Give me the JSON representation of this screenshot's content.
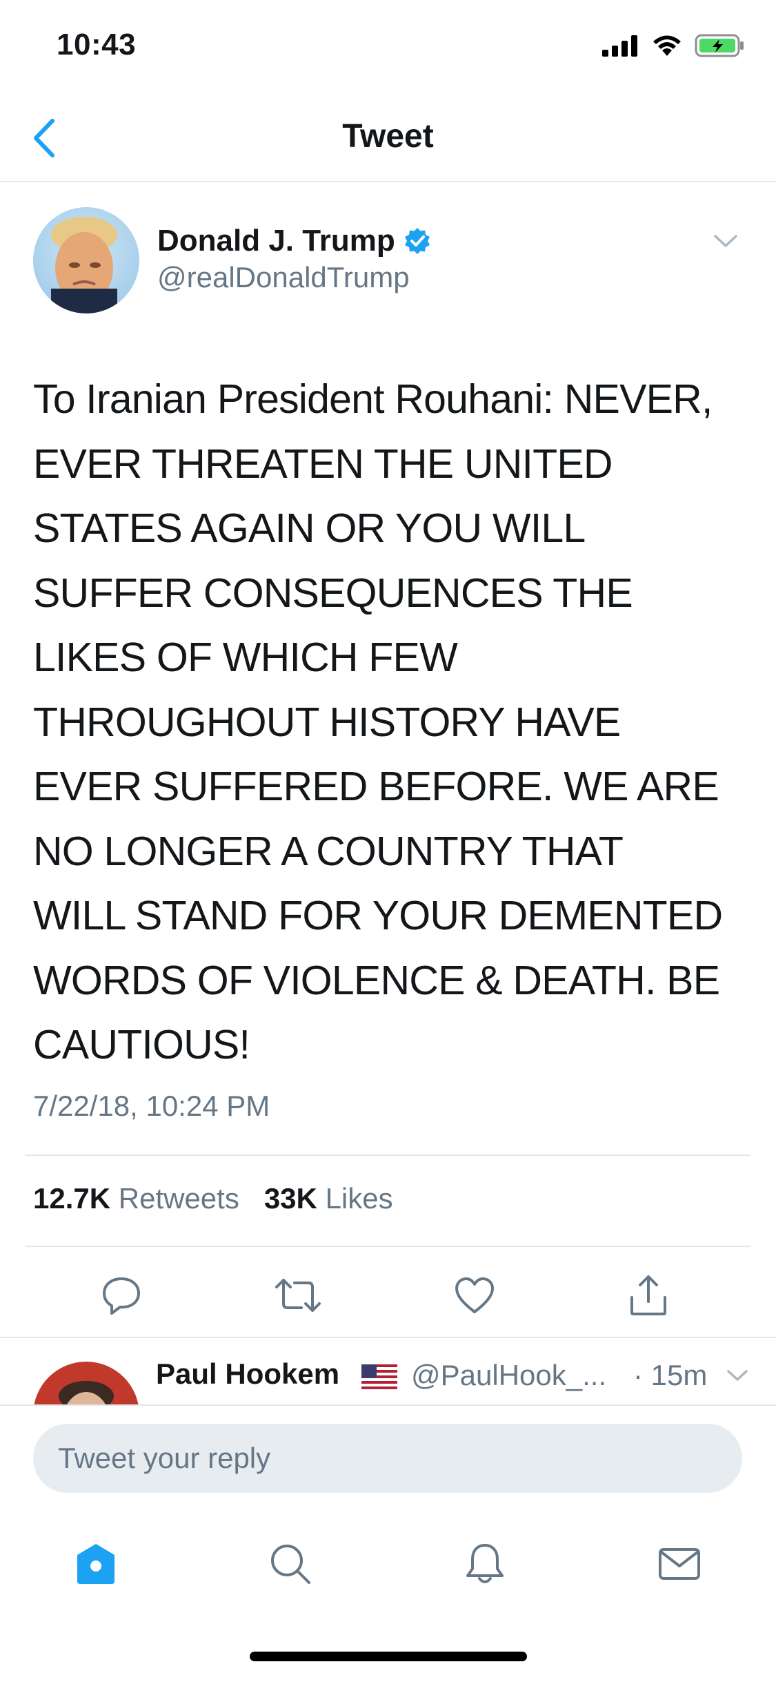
{
  "status_bar": {
    "time": "10:43"
  },
  "nav": {
    "title": "Tweet"
  },
  "tweet": {
    "author_name": "Donald J. Trump",
    "author_handle": "@realDonaldTrump",
    "verified": true,
    "text": "To Iranian President Rouhani: NEVER,\nEVER THREATEN THE UNITED\nSTATES AGAIN OR YOU WILL\nSUFFER CONSEQUENCES THE\nLIKES OF WHICH FEW\nTHROUGHOUT HISTORY HAVE\nEVER SUFFERED BEFORE. WE ARE\nNO LONGER A COUNTRY THAT\nWILL STAND FOR YOUR DEMENTED\nWORDS OF VIOLENCE & DEATH. BE\nCAUTIOUS!",
    "timestamp": "7/22/18, 10:24 PM",
    "retweets_count": "12.7K",
    "retweets_label": "Retweets",
    "likes_count": "33K",
    "likes_label": "Likes"
  },
  "reply_preview": {
    "name": "Paul Hookem",
    "handle": "@PaulHook_...",
    "time": "· 15m"
  },
  "reply_box": {
    "placeholder": "Tweet your reply"
  },
  "colors": {
    "accent": "#1da1f2",
    "secondary_text": "#657786",
    "divider": "#e1e8ed",
    "battery_green": "#4cd964"
  },
  "icons": {
    "back": "chevron-left-icon",
    "verified": "verified-badge-icon",
    "more": "chevron-down-icon",
    "reply": "reply-icon",
    "retweet": "retweet-icon",
    "like": "heart-icon",
    "share": "share-icon",
    "home": "home-icon",
    "search": "search-icon",
    "notifications": "bell-icon",
    "messages": "mail-icon"
  }
}
